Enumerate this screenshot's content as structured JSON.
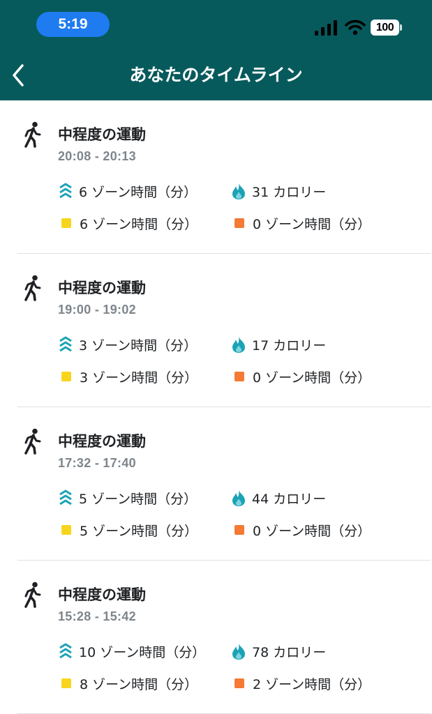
{
  "status_bar": {
    "time": "5:19",
    "battery": "100",
    "icons": [
      "signal-icon",
      "wifi-icon",
      "battery-icon"
    ]
  },
  "header": {
    "title": "あなたのタイムライン",
    "back_icon": "chevron-left-icon"
  },
  "colors": {
    "header_bg": "#075a5c",
    "zone_icon": "#1aa3b5",
    "fat_burn": "#f7d51d",
    "peak": "#f47a35"
  },
  "entries": [
    {
      "title": "中程度の運動",
      "time": "20:08 - 20:13",
      "azm": "6 ゾーン時間（分）",
      "calories": "31 カロリー",
      "fat_burn": "6 ゾーン時間（分）",
      "peak": "0 ゾーン時間（分）"
    },
    {
      "title": "中程度の運動",
      "time": "19:00 - 19:02",
      "azm": "3 ゾーン時間（分）",
      "calories": "17 カロリー",
      "fat_burn": "3 ゾーン時間（分）",
      "peak": "0 ゾーン時間（分）"
    },
    {
      "title": "中程度の運動",
      "time": "17:32 - 17:40",
      "azm": "5 ゾーン時間（分）",
      "calories": "44 カロリー",
      "fat_burn": "5 ゾーン時間（分）",
      "peak": "0 ゾーン時間（分）"
    },
    {
      "title": "中程度の運動",
      "time": "15:28 - 15:42",
      "azm": "10 ゾーン時間（分）",
      "calories": "78 カロリー",
      "fat_burn": "8 ゾーン時間（分）",
      "peak": "2 ゾーン時間（分）"
    }
  ]
}
